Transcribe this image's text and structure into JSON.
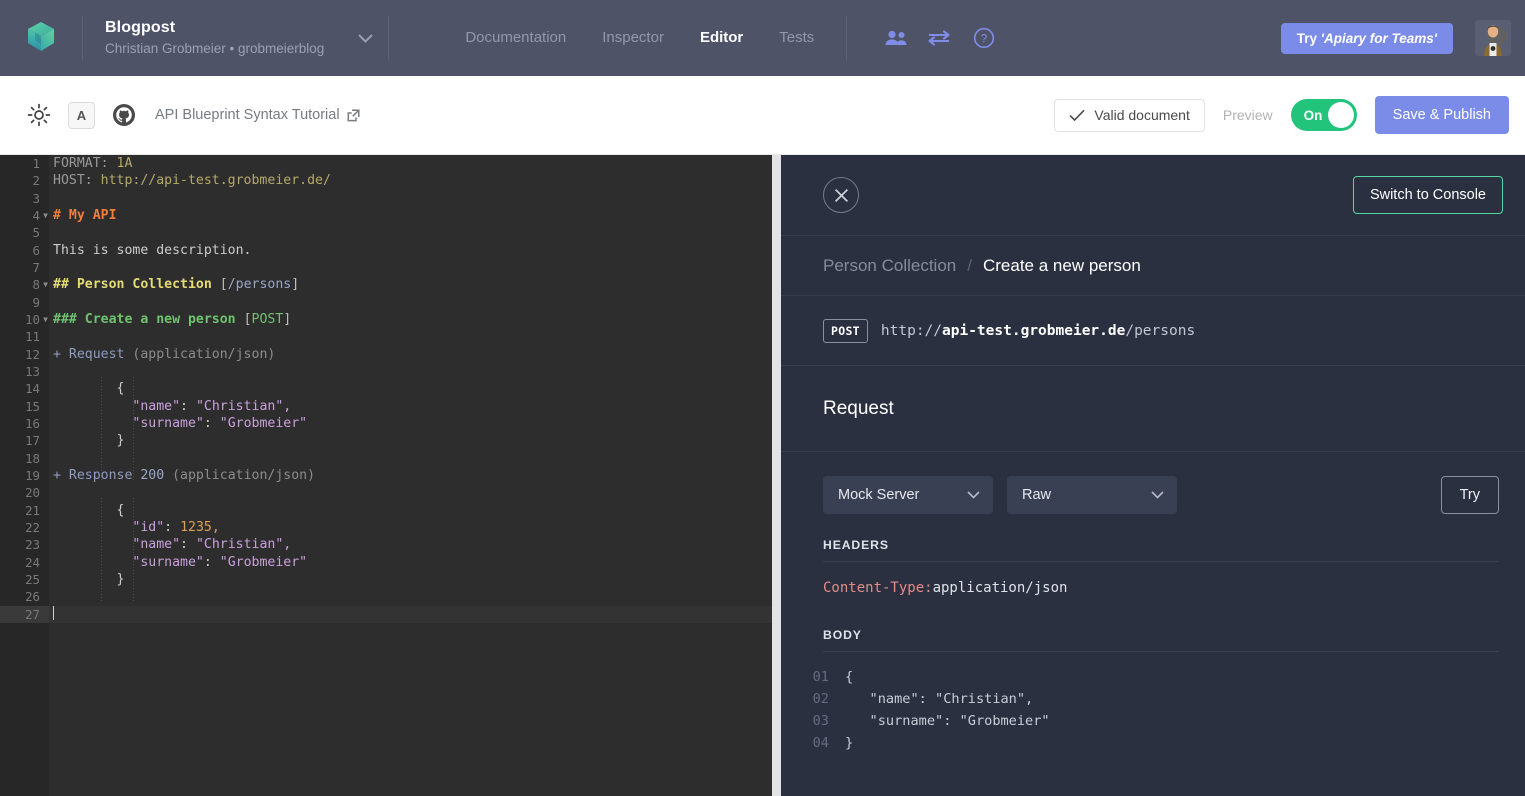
{
  "header": {
    "logo_icon": "apiary-logo-icon",
    "project": {
      "title": "Blogpost",
      "subtitle": "Christian Grobmeier • grobmeierblog",
      "chevron_icon": "chevron-down-icon"
    },
    "nav": [
      {
        "label": "Documentation",
        "active": false
      },
      {
        "label": "Inspector",
        "active": false
      },
      {
        "label": "Editor",
        "active": true
      },
      {
        "label": "Tests",
        "active": false
      }
    ],
    "icons": [
      {
        "name": "users-icon"
      },
      {
        "name": "settings-sliders-icon"
      },
      {
        "name": "help-question-icon"
      }
    ],
    "teams_button": {
      "prefix": "Try ",
      "emphasis": "'Apiary for Teams'"
    },
    "avatar": "user-avatar"
  },
  "toolbar": {
    "brightness_icon": "sun-brightness-icon",
    "font_button": "A",
    "github_icon": "github-icon",
    "tutorial_link": "API Blueprint Syntax Tutorial",
    "external_icon": "external-link-icon",
    "valid_document": "Valid document",
    "check_icon": "check-icon",
    "preview_label": "Preview",
    "toggle_state": "On",
    "save_label": "Save & Publish",
    "accent_color": "#7b8ce8",
    "toggle_color": "#22c37b"
  },
  "editor": {
    "total_lines": 27,
    "active_line": 27,
    "lines": [
      {
        "n": 1,
        "fold": false
      },
      {
        "n": 2,
        "fold": false
      },
      {
        "n": 3,
        "fold": false
      },
      {
        "n": 4,
        "fold": true
      },
      {
        "n": 5,
        "fold": false
      },
      {
        "n": 6,
        "fold": false
      },
      {
        "n": 7,
        "fold": false
      },
      {
        "n": 8,
        "fold": true
      },
      {
        "n": 9,
        "fold": false
      },
      {
        "n": 10,
        "fold": true
      },
      {
        "n": 11,
        "fold": false
      },
      {
        "n": 12,
        "fold": false
      },
      {
        "n": 13,
        "fold": false
      },
      {
        "n": 14,
        "fold": false
      },
      {
        "n": 15,
        "fold": false
      },
      {
        "n": 16,
        "fold": false
      },
      {
        "n": 17,
        "fold": false
      },
      {
        "n": 18,
        "fold": false
      },
      {
        "n": 19,
        "fold": false
      },
      {
        "n": 20,
        "fold": false
      },
      {
        "n": 21,
        "fold": false
      },
      {
        "n": 22,
        "fold": false
      },
      {
        "n": 23,
        "fold": false
      },
      {
        "n": 24,
        "fold": false
      },
      {
        "n": 25,
        "fold": false
      },
      {
        "n": 26,
        "fold": false
      },
      {
        "n": 27,
        "fold": false
      }
    ],
    "source": [
      "FORMAT: 1A",
      "HOST: http://api-test.grobmeier.de/",
      "",
      "# My API",
      "",
      "This is some description.",
      "",
      "## Person Collection [/persons]",
      "",
      "### Create a new person [POST]",
      "",
      "+ Request (application/json)",
      "",
      "        {",
      "          \"name\": \"Christian\",",
      "          \"surname\": \"Grobmeier\"",
      "        }",
      "",
      "+ Response 200 (application/json)",
      "",
      "        {",
      "          \"id\": 1235,",
      "          \"name\": \"Christian\",",
      "          \"surname\": \"Grobmeier\"",
      "        }",
      "",
      ""
    ]
  },
  "panel": {
    "close_icon": "close-x-icon",
    "switch_console": "Switch to Console",
    "breadcrumb": {
      "parent": "Person Collection",
      "separator": "/",
      "current": "Create a new person"
    },
    "request_url": {
      "method": "POST",
      "scheme": "http://",
      "host": "api-test.grobmeier.de",
      "path": "/persons"
    },
    "section_title": "Request",
    "server_select": {
      "value": "Mock Server",
      "chevron_icon": "chevron-down-icon"
    },
    "format_select": {
      "value": "Raw",
      "chevron_icon": "chevron-down-icon"
    },
    "try_button": "Try",
    "headers_label": "HEADERS",
    "header_entry": {
      "key": "Content-Type:",
      "value": "application/json"
    },
    "body_label": "BODY",
    "body_lines": [
      {
        "n": "01",
        "text": "{"
      },
      {
        "n": "02",
        "text": "   \"name\": \"Christian\","
      },
      {
        "n": "03",
        "text": "   \"surname\": \"Grobmeier\""
      },
      {
        "n": "04",
        "text": "}"
      }
    ],
    "accent_green": "#55d6a4"
  }
}
